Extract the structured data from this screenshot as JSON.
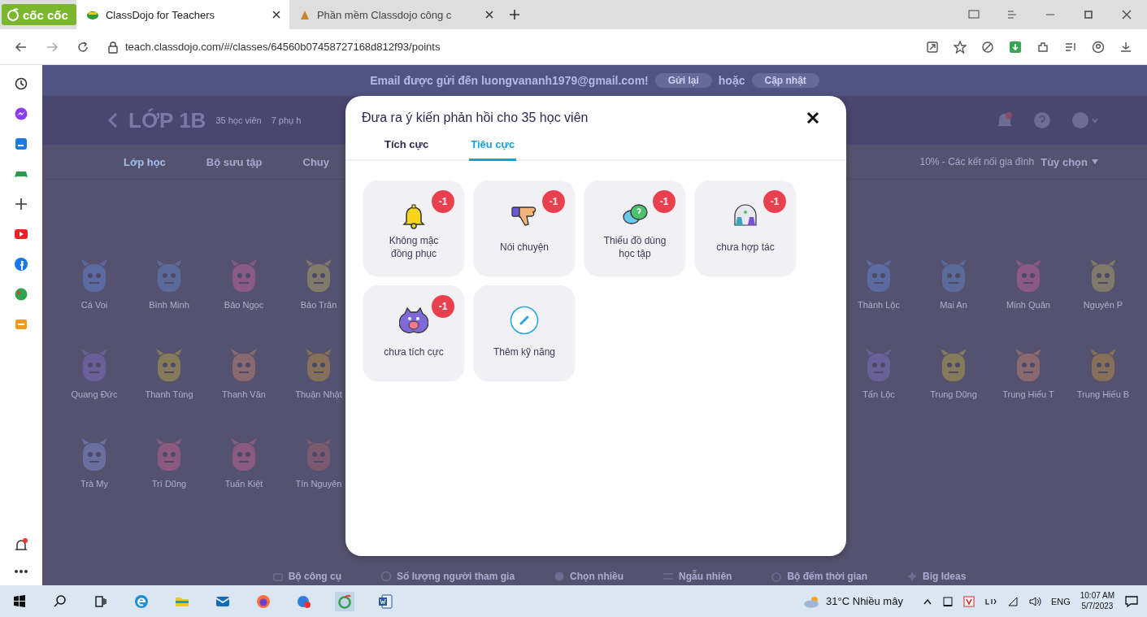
{
  "browser": {
    "logo": "cốc cốc",
    "tabs": [
      {
        "title": "ClassDojo for Teachers",
        "selected": true
      },
      {
        "title": "Phần mềm Classdojo công c",
        "selected": false
      }
    ],
    "url": "teach.classdojo.com/#/classes/64560b07458727168d812f93/points"
  },
  "page": {
    "banner": {
      "message": "Email được gửi đến luongvananh1979@gmail.com!",
      "resend": "Gửi lại",
      "or": "hoặc",
      "update": "Cập nhật"
    },
    "class_header": {
      "name": "LỚP 1B",
      "students": "35 học viên",
      "parents": "7 phụ h"
    },
    "nav": [
      {
        "label": "Lớp học",
        "selected": true
      },
      {
        "label": "Bộ sưu tập",
        "selected": false
      },
      {
        "label": "Chuy",
        "selected": false
      }
    ],
    "connections": "10% - Các kết nối gia đình",
    "options": "Tùy chọn",
    "students_left": [
      {
        "name": "Cá Voi"
      },
      {
        "name": "Bình Minh"
      },
      {
        "name": "Bảo Ngọc"
      },
      {
        "name": "Bảo Trân"
      },
      {
        "name": "Quang Đức"
      },
      {
        "name": "Thanh Tùng"
      },
      {
        "name": "Thanh Vân"
      },
      {
        "name": "Thuận Nhật"
      },
      {
        "name": "Trà My"
      },
      {
        "name": "Trí Dũng"
      },
      {
        "name": "Tuấn Kiệt"
      },
      {
        "name": "Tín Nguyên"
      }
    ],
    "students_right": [
      {
        "name": "Thành Lộc"
      },
      {
        "name": "Mai An"
      },
      {
        "name": "Minh Quân"
      },
      {
        "name": "Nguyên P"
      },
      {
        "name": "Tấn Lộc"
      },
      {
        "name": "Trung Dũng"
      },
      {
        "name": "Trung Hiếu T"
      },
      {
        "name": "Trung Hiếu B"
      }
    ],
    "toolbar": [
      "Bộ công cụ",
      "Số lượng người tham gia",
      "Chọn nhiều",
      "Ngẫu nhiên",
      "Bộ đếm thời gian",
      "Big Ideas"
    ]
  },
  "dialog": {
    "title": "Đưa ra ý kiến phản hồi cho 35 học viên",
    "tabs": [
      {
        "label": "Tích cực",
        "selected": false
      },
      {
        "label": "Tiêu cực",
        "selected": true
      }
    ],
    "skills": [
      {
        "kind": "skill",
        "label": "Không mặc đồng phục",
        "points": "-1"
      },
      {
        "kind": "skill",
        "label": "Nói chuyện",
        "points": "-1"
      },
      {
        "kind": "skill",
        "label": "Thiếu đồ dùng học tập",
        "points": "-1"
      },
      {
        "kind": "skill",
        "label": "chưa hợp tác",
        "points": "-1"
      },
      {
        "kind": "skill",
        "label": "chưa tích cực",
        "points": "-1"
      },
      {
        "kind": "add",
        "label": "Thêm kỹ năng"
      }
    ]
  },
  "taskbar": {
    "weather": "31°C Nhiều mây",
    "language": "ENG",
    "time": "10:07 AM",
    "date": "5/7/2023"
  }
}
